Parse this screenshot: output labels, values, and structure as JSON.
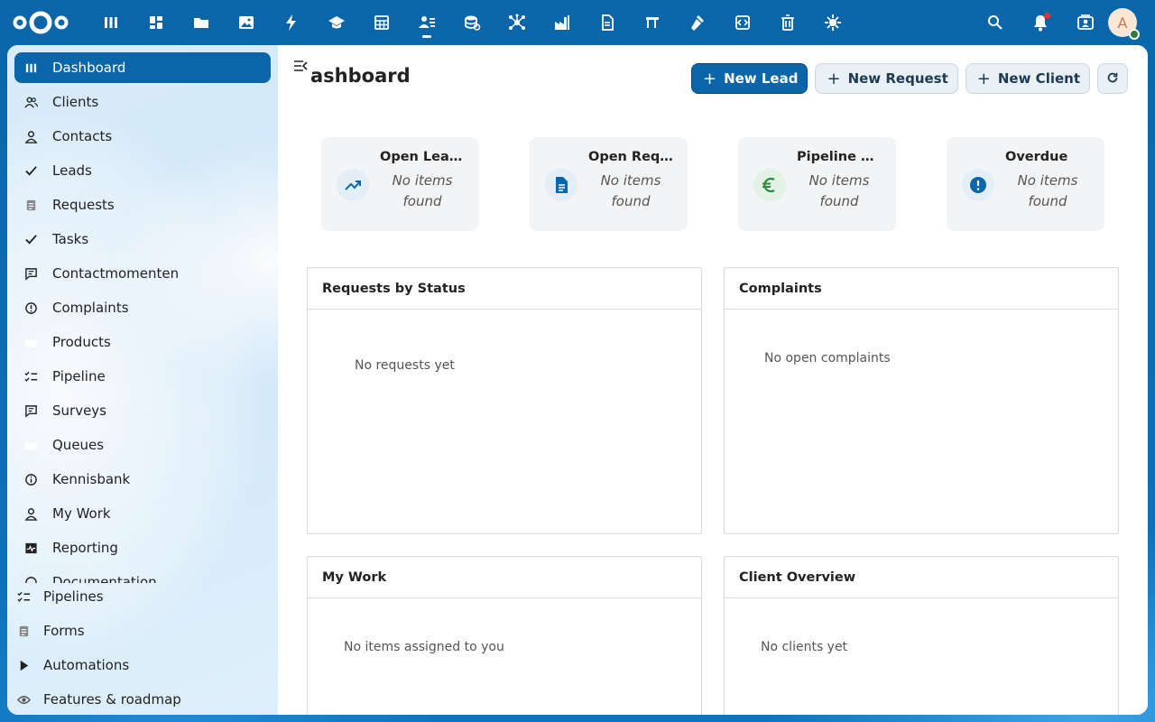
{
  "header": {
    "apps": [
      {
        "icon": "dashboard-icon"
      },
      {
        "icon": "apps-grid-icon"
      },
      {
        "icon": "files-icon"
      },
      {
        "icon": "photos-icon"
      },
      {
        "icon": "activity-icon"
      },
      {
        "icon": "education-icon"
      },
      {
        "icon": "spreadsheet-icon"
      },
      {
        "icon": "crm-contacts-icon",
        "active": true
      },
      {
        "icon": "database-icon"
      },
      {
        "icon": "network-icon"
      },
      {
        "icon": "factory-icon"
      },
      {
        "icon": "document-icon"
      },
      {
        "icon": "flag-icon"
      },
      {
        "icon": "gavel-icon"
      },
      {
        "icon": "code-icon"
      },
      {
        "icon": "trash-icon"
      },
      {
        "icon": "settings-bug-icon"
      }
    ],
    "avatar_letter": "A"
  },
  "sidebar": {
    "items": [
      {
        "label": "Dashboard",
        "icon": "dashboard-icon",
        "active": true
      },
      {
        "label": "Clients",
        "icon": "users-icon"
      },
      {
        "label": "Contacts",
        "icon": "user-icon"
      },
      {
        "label": "Leads",
        "icon": "check-icon"
      },
      {
        "label": "Requests",
        "icon": "document-icon"
      },
      {
        "label": "Tasks",
        "icon": "check-icon"
      },
      {
        "label": "Contactmomenten",
        "icon": "message-icon"
      },
      {
        "label": "Complaints",
        "icon": "alert-circle-icon"
      },
      {
        "label": "Products",
        "icon": "folder-icon"
      },
      {
        "label": "Pipeline",
        "icon": "checklist-icon"
      },
      {
        "label": "Surveys",
        "icon": "message-icon"
      },
      {
        "label": "Queues",
        "icon": "folder-icon"
      },
      {
        "label": "Kennisbank",
        "icon": "info-icon"
      },
      {
        "label": "My Work",
        "icon": "user-icon"
      },
      {
        "label": "Reporting",
        "icon": "chart-icon"
      },
      {
        "label": "Documentation",
        "icon": "help-icon"
      }
    ],
    "bottom_items": [
      {
        "label": "Pipelines",
        "icon": "checklist-icon"
      },
      {
        "label": "Forms",
        "icon": "document-icon"
      },
      {
        "label": "Automations",
        "icon": "play-icon"
      },
      {
        "label": "Features & roadmap",
        "icon": "eye-icon"
      }
    ]
  },
  "main": {
    "title": "ashboard",
    "actions": {
      "new_lead": "New Lead",
      "new_request": "New Request",
      "new_client": "New Client",
      "plus": "+"
    },
    "stats": [
      {
        "title": "Open Leads",
        "empty": "No items found",
        "icon": "trending-up-icon",
        "icon_color": "#0a66a8",
        "bg": "#e4eef6"
      },
      {
        "title": "Open Requests",
        "empty": "No items found",
        "icon": "file-text-icon",
        "icon_color": "#0a66a8",
        "bg": "#e4eef6"
      },
      {
        "title": "Pipeline Value",
        "empty": "No items found",
        "icon": "euro-icon",
        "icon_color": "#2d8a3e",
        "bg": "#e2f2e5"
      },
      {
        "title": "Overdue",
        "empty": "No items found",
        "icon": "alert-circle-icon",
        "icon_color": "#0a66a8",
        "bg": "#e4eef6"
      }
    ],
    "panels": {
      "requests_by_status": {
        "title": "Requests by Status",
        "empty": "No requests yet"
      },
      "complaints": {
        "title": "Complaints",
        "empty": "No open complaints"
      },
      "my_work": {
        "title": "My Work",
        "empty": "No items assigned to you"
      },
      "client_overview": {
        "title": "Client Overview",
        "empty": "No clients yet"
      }
    }
  }
}
